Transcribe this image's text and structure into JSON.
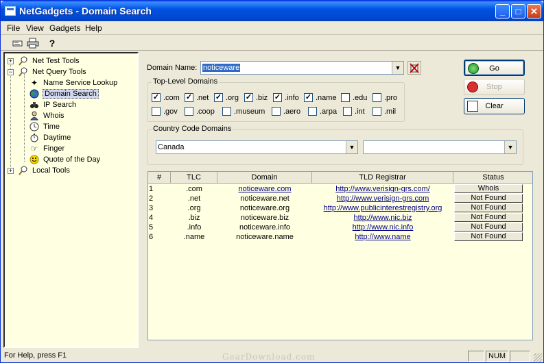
{
  "window": {
    "title": "NetGadgets - Domain Search"
  },
  "menu": {
    "file": "File",
    "view": "View",
    "gadgets": "Gadgets",
    "help": "Help"
  },
  "toolbar": {
    "icons": [
      "back-icon",
      "print-icon",
      "help-icon"
    ],
    "help_glyph": "?"
  },
  "tree": {
    "net_test_tools": "Net Test Tools",
    "net_query_tools": "Net Query Tools",
    "items": [
      {
        "label": "Name Service Lookup",
        "icon": "name-service-icon"
      },
      {
        "label": "Domain Search",
        "icon": "globe-icon",
        "selected": true
      },
      {
        "label": "IP Search",
        "icon": "binoculars-icon"
      },
      {
        "label": "Whois",
        "icon": "whois-icon"
      },
      {
        "label": "Time",
        "icon": "clock-icon"
      },
      {
        "label": "Daytime",
        "icon": "stopwatch-icon"
      },
      {
        "label": "Finger",
        "icon": "finger-icon"
      },
      {
        "label": "Quote of the Day",
        "icon": "smiley-icon"
      }
    ],
    "local_tools": "Local Tools"
  },
  "domain_name": {
    "label": "Domain Name:",
    "value": "noticeware"
  },
  "tld_group": {
    "title": "Top-Level Domains",
    "options": [
      {
        "label": ".com",
        "checked": true
      },
      {
        "label": ".net",
        "checked": true
      },
      {
        "label": ".org",
        "checked": true
      },
      {
        "label": ".biz",
        "checked": true
      },
      {
        "label": ".info",
        "checked": true
      },
      {
        "label": ".name",
        "checked": true
      },
      {
        "label": ".edu",
        "checked": false
      },
      {
        "label": ".pro",
        "checked": false
      },
      {
        "label": ".gov",
        "checked": false
      },
      {
        "label": ".coop",
        "checked": false
      },
      {
        "label": ".museum",
        "checked": false
      },
      {
        "label": ".aero",
        "checked": false
      },
      {
        "label": ".arpa",
        "checked": false
      },
      {
        "label": ".int",
        "checked": false
      },
      {
        "label": ".mil",
        "checked": false
      }
    ]
  },
  "country_group": {
    "title": "Country Code Domains",
    "country": "Canada",
    "second": ""
  },
  "buttons": {
    "go": "Go",
    "stop": "Stop",
    "clear": "Clear"
  },
  "results": {
    "headers": [
      "#",
      "TLC",
      "Domain",
      "TLD Registrar",
      "Status"
    ],
    "rows": [
      {
        "n": "1",
        "tlc": ".com",
        "domain": "noticeware.com",
        "registrar": "http://www.verisign-grs.com/",
        "status": "Whois",
        "domain_link": true
      },
      {
        "n": "2",
        "tlc": ".net",
        "domain": "noticeware.net",
        "registrar": "http://www.verisign-grs.com",
        "status": "Not Found",
        "domain_link": false
      },
      {
        "n": "3",
        "tlc": ".org",
        "domain": "noticeware.org",
        "registrar": "http://www.publicinterestregistry.org",
        "status": "Not Found",
        "domain_link": false
      },
      {
        "n": "4",
        "tlc": ".biz",
        "domain": "noticeware.biz",
        "registrar": "http://www.nic.biz",
        "status": "Not Found",
        "domain_link": false
      },
      {
        "n": "5",
        "tlc": ".info",
        "domain": "noticeware.info",
        "registrar": "http://www.nic.info",
        "status": "Not Found",
        "domain_link": false
      },
      {
        "n": "6",
        "tlc": ".name",
        "domain": "noticeware.name",
        "registrar": "http://www.name",
        "status": "Not Found",
        "domain_link": false
      }
    ]
  },
  "statusbar": {
    "help": "For Help, press F1",
    "num": "NUM"
  },
  "watermark": "GearDownload.com",
  "colors": {
    "title_bar": "#0054e3",
    "pane_bg": "#ffffe1",
    "link": "#00008b",
    "selection": "#316ac5"
  }
}
